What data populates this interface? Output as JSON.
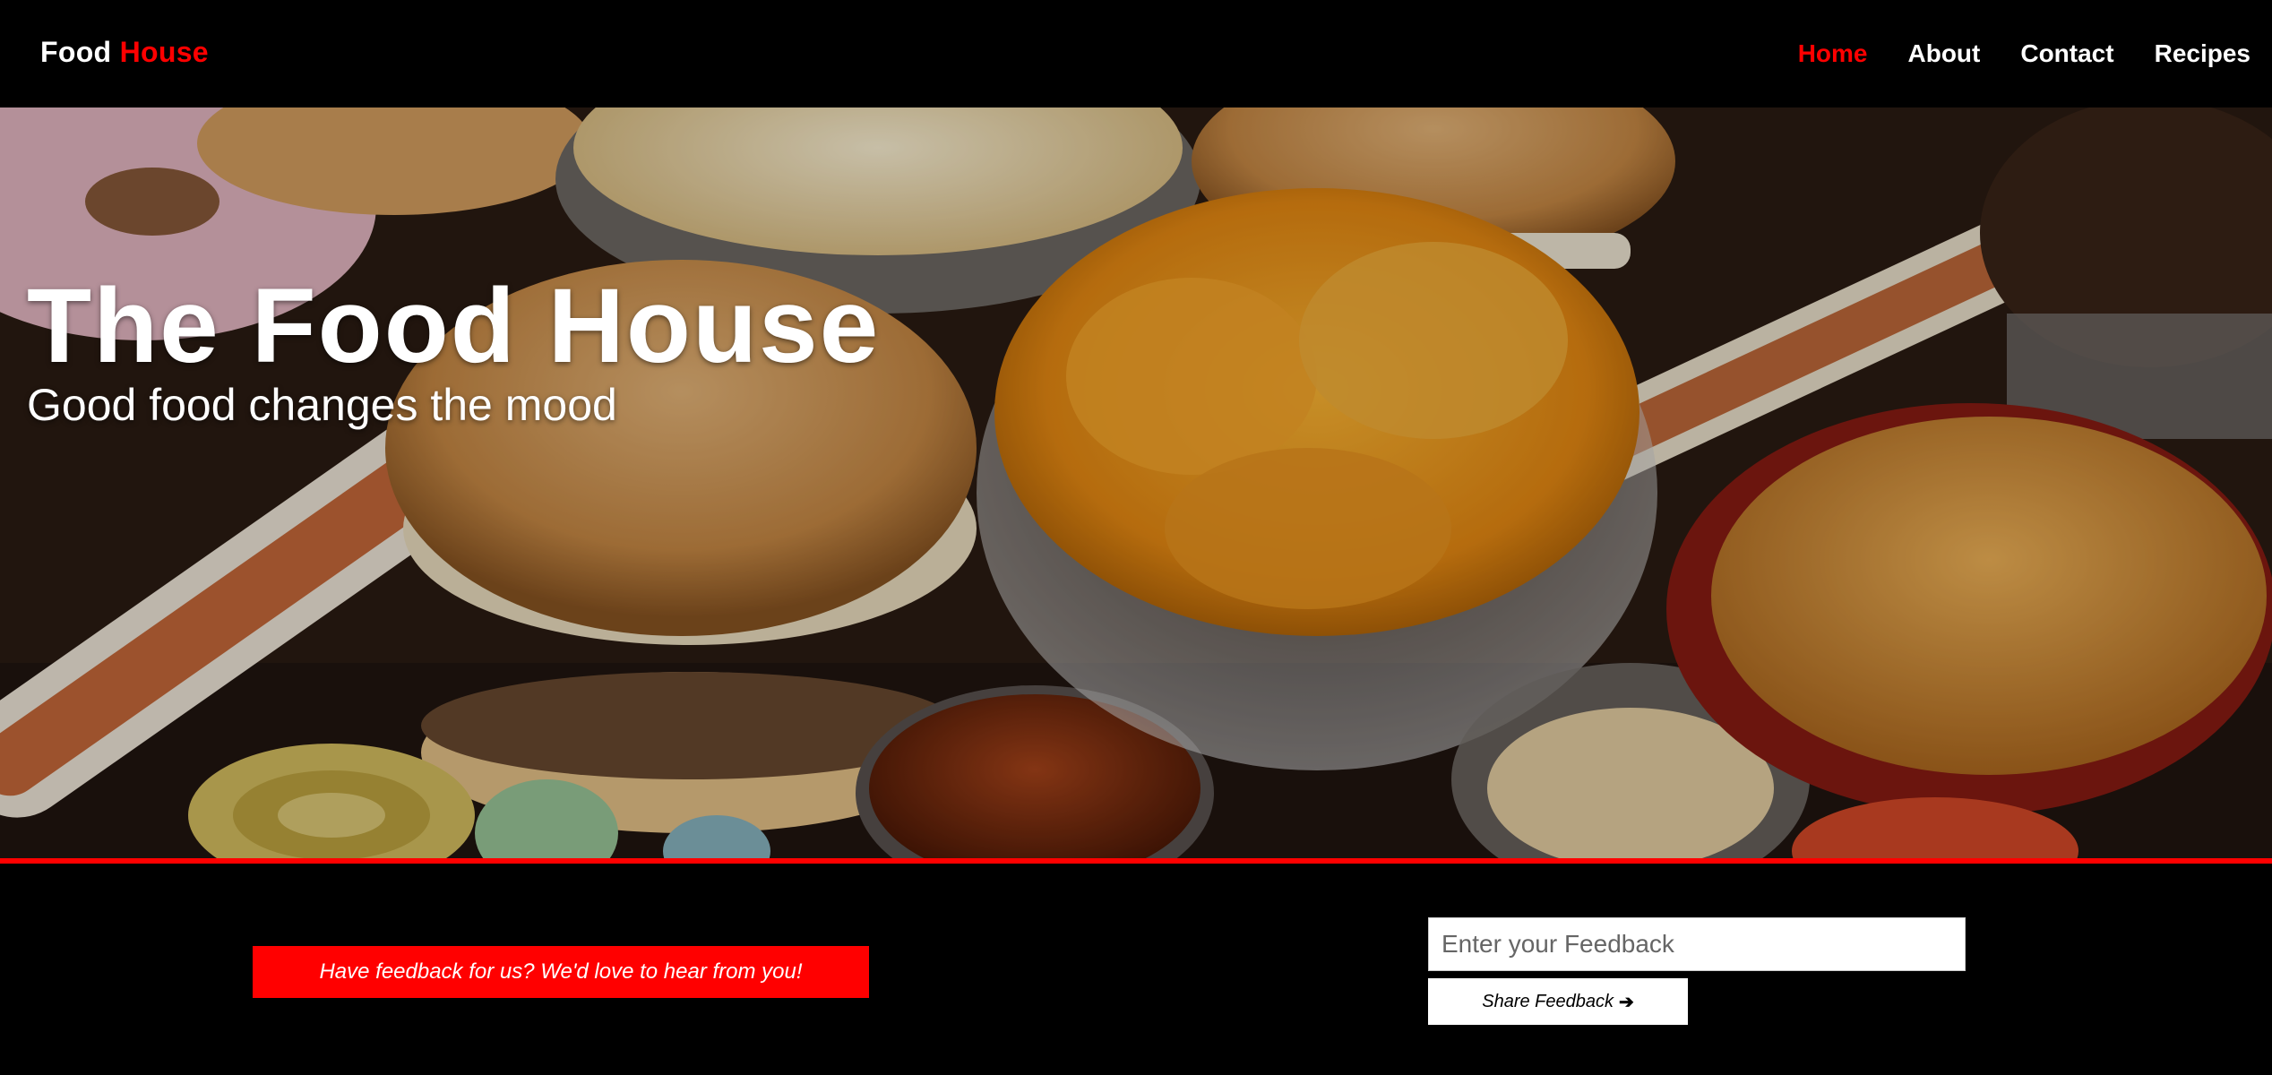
{
  "brand": {
    "part1": "Food",
    "part2": "House"
  },
  "nav": {
    "items": [
      {
        "label": "Home",
        "active": true
      },
      {
        "label": "About",
        "active": false
      },
      {
        "label": "Contact",
        "active": false
      },
      {
        "label": "Recipes",
        "active": false
      }
    ]
  },
  "hero": {
    "title": "The Food House",
    "subtitle": "Good food changes the mood"
  },
  "feedback": {
    "banner": "Have feedback for us? We'd love to hear from you!",
    "input_placeholder": "Enter your Feedback",
    "input_value": "",
    "button_label": "Share Feedback",
    "button_icon": "arrow-right-icon"
  },
  "colors": {
    "accent": "#ff0000",
    "background": "#000000",
    "text": "#ffffff"
  }
}
